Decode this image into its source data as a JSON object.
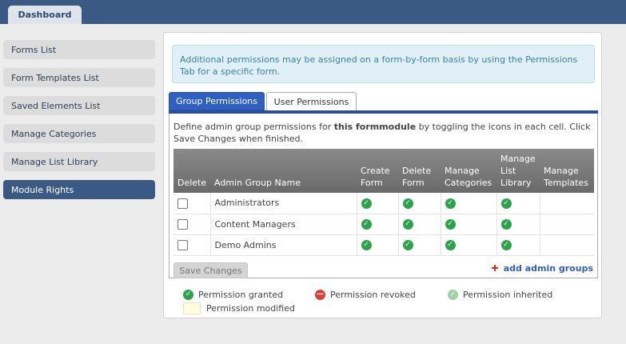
{
  "topbar": {
    "tab_label": "Dashboard"
  },
  "sidebar": {
    "items": [
      {
        "label": "Forms List"
      },
      {
        "label": "Form Templates List"
      },
      {
        "label": "Saved Elements List"
      },
      {
        "label": "Manage Categories"
      },
      {
        "label": "Manage List Library"
      },
      {
        "label": "Module Rights",
        "active": true
      }
    ]
  },
  "info": {
    "text": "Additional permissions may be assigned on a form-by-form basis by using the Permissions Tab for a specific form."
  },
  "tabs": {
    "group": "Group Permissions",
    "user": "User Permissions"
  },
  "description": {
    "before": "Define admin group permissions for ",
    "bold": "this formmodule",
    "after": " by toggling the icons in each cell. Click Save Changes when finished."
  },
  "table": {
    "headers": {
      "delete": "Delete",
      "name": "Admin Group Name",
      "create_l1": "Create",
      "create_l2": "Form",
      "delete_form_l1": "Delete",
      "delete_form_l2": "Form",
      "categories_l1": "Manage",
      "categories_l2": "Categories",
      "list_l1": "Manage",
      "list_l2": "List",
      "list_l3": "Library",
      "templates_l1": "Manage",
      "templates_l2": "Templates"
    },
    "rows": [
      {
        "name": "Administrators",
        "create": "granted",
        "delete": "granted",
        "categories": "granted",
        "list": "granted",
        "templates": ""
      },
      {
        "name": "Content Managers",
        "create": "granted",
        "delete": "granted",
        "categories": "granted",
        "list": "granted",
        "templates": ""
      },
      {
        "name": "Demo Admins",
        "create": "granted",
        "delete": "granted",
        "categories": "granted",
        "list": "granted",
        "templates": ""
      }
    ]
  },
  "actions": {
    "save_label": "Save Changes",
    "add_label": "add admin groups",
    "add_icon": "plus-icon"
  },
  "legend": {
    "granted": "Permission granted",
    "revoked": "Permission revoked",
    "inherited": "Permission inherited",
    "modified": "Permission modified"
  },
  "colors": {
    "header_bar": "#3b5a83",
    "active_tab": "#2f5fc0",
    "granted": "#2aa34a",
    "revoked": "#d9403a",
    "inherited": "#9bd3a4",
    "modified": "#fffce0"
  }
}
